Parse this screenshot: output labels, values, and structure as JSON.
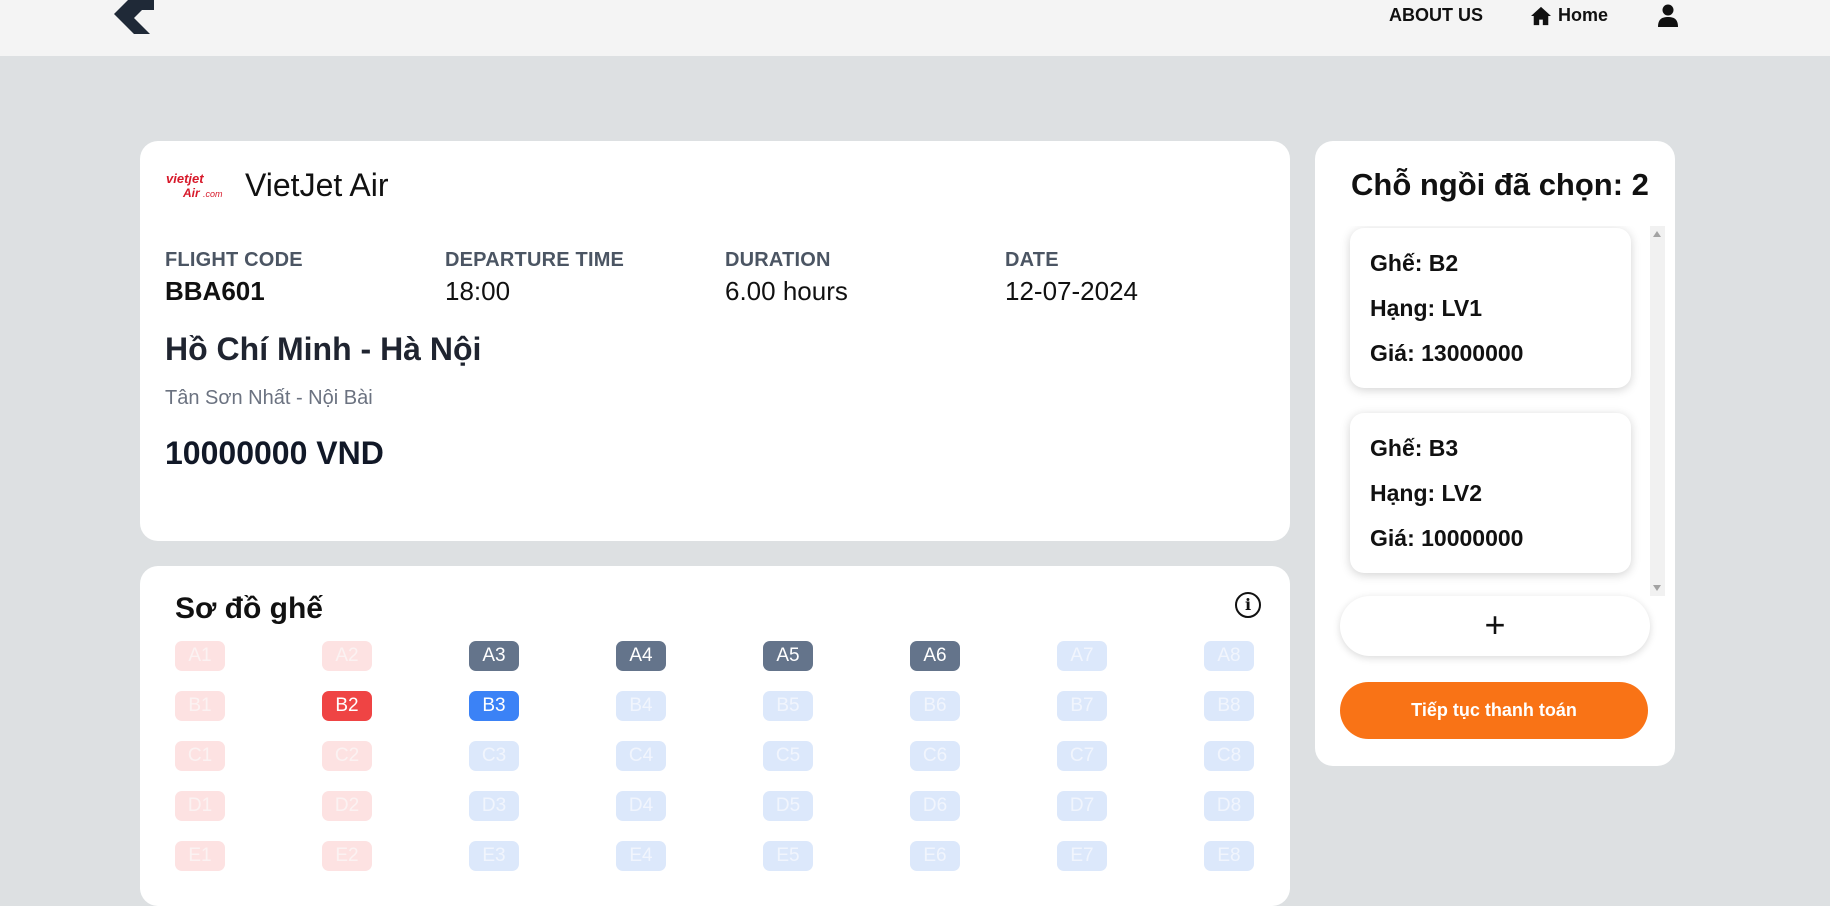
{
  "nav": {
    "about": "ABOUT US",
    "home": "Home"
  },
  "flight": {
    "airline_logo_text": "vietjet Air.com",
    "airline": "VietJet Air",
    "flight_code_label": "FLIGHT CODE",
    "flight_code": "BBA601",
    "departure_label": "DEPARTURE TIME",
    "departure": "18:00",
    "duration_label": "DURATION",
    "duration": "6.00 hours",
    "date_label": "DATE",
    "date": "12-07-2024",
    "route": "Hồ Chí Minh - Hà Nội",
    "airports": "Tân Sơn Nhất - Nội Bài",
    "price": "10000000 VND"
  },
  "seatmap": {
    "title": "Sơ đồ ghế",
    "info_icon": "i",
    "rows": [
      {
        "seats": [
          {
            "label": "A1",
            "state": "red-free"
          },
          {
            "label": "A2",
            "state": "red-free"
          },
          {
            "label": "A3",
            "state": "booked"
          },
          {
            "label": "A4",
            "state": "booked"
          },
          {
            "label": "A5",
            "state": "booked"
          },
          {
            "label": "A6",
            "state": "booked"
          },
          {
            "label": "A7",
            "state": "blue-free"
          },
          {
            "label": "A8",
            "state": "blue-free"
          }
        ]
      },
      {
        "seats": [
          {
            "label": "B1",
            "state": "red-free"
          },
          {
            "label": "B2",
            "state": "sel-red"
          },
          {
            "label": "B3",
            "state": "sel-blue"
          },
          {
            "label": "B4",
            "state": "blue-free"
          },
          {
            "label": "B5",
            "state": "blue-free"
          },
          {
            "label": "B6",
            "state": "blue-free"
          },
          {
            "label": "B7",
            "state": "blue-free"
          },
          {
            "label": "B8",
            "state": "blue-free"
          }
        ]
      },
      {
        "seats": [
          {
            "label": "C1",
            "state": "red-free"
          },
          {
            "label": "C2",
            "state": "red-free"
          },
          {
            "label": "C3",
            "state": "blue-free"
          },
          {
            "label": "C4",
            "state": "blue-free"
          },
          {
            "label": "C5",
            "state": "blue-free"
          },
          {
            "label": "C6",
            "state": "blue-free"
          },
          {
            "label": "C7",
            "state": "blue-free"
          },
          {
            "label": "C8",
            "state": "blue-free"
          }
        ]
      },
      {
        "seats": [
          {
            "label": "D1",
            "state": "red-free"
          },
          {
            "label": "D2",
            "state": "red-free"
          },
          {
            "label": "D3",
            "state": "blue-free"
          },
          {
            "label": "D4",
            "state": "blue-free"
          },
          {
            "label": "D5",
            "state": "blue-free"
          },
          {
            "label": "D6",
            "state": "blue-free"
          },
          {
            "label": "D7",
            "state": "blue-free"
          },
          {
            "label": "D8",
            "state": "blue-free"
          }
        ]
      },
      {
        "seats": [
          {
            "label": "E1",
            "state": "red-free"
          },
          {
            "label": "E2",
            "state": "red-free"
          },
          {
            "label": "E3",
            "state": "blue-free"
          },
          {
            "label": "E4",
            "state": "blue-free"
          },
          {
            "label": "E5",
            "state": "blue-free"
          },
          {
            "label": "E6",
            "state": "blue-free"
          },
          {
            "label": "E7",
            "state": "blue-free"
          },
          {
            "label": "E8",
            "state": "blue-free"
          }
        ]
      }
    ]
  },
  "selection": {
    "title": "Chỗ ngồi đã chọn: 2",
    "items": [
      {
        "seat": "Ghế: B2",
        "class": "Hạng: LV1",
        "price": "Giá: 13000000"
      },
      {
        "seat": "Ghế: B3",
        "class": "Hạng: LV2",
        "price": "Giá: 10000000"
      }
    ],
    "add_label": "+",
    "pay_label": "Tiếp tục thanh toán"
  },
  "colors": {
    "accent": "#f97316",
    "selected_red": "#ef4444",
    "selected_blue": "#3b82f6",
    "booked": "#64748b"
  },
  "icons": [
    "back-arrow-logo-icon",
    "home-icon",
    "user-icon",
    "vietjet-logo",
    "info-icon",
    "scroll-up-icon",
    "scroll-down-icon"
  ]
}
